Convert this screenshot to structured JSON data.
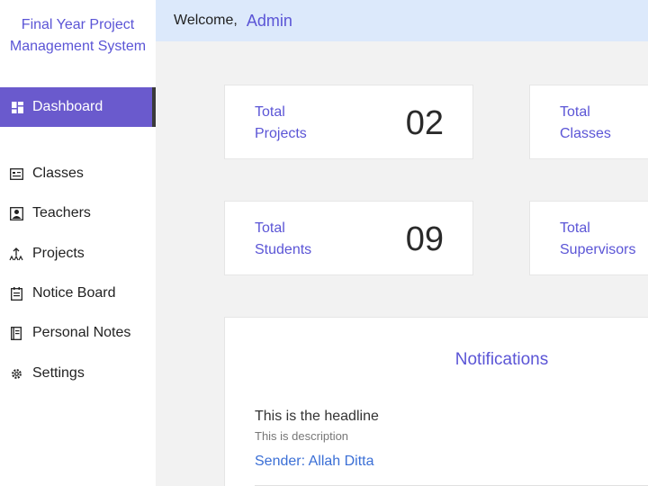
{
  "sidebar": {
    "brand_line1": "Final Year Project",
    "brand_line2": "Management System",
    "items": [
      {
        "label": "Dashboard",
        "icon": "dashboard-icon",
        "active": true
      },
      {
        "label": "Classes",
        "icon": "classes-icon"
      },
      {
        "label": "Teachers",
        "icon": "teachers-icon"
      },
      {
        "label": "Projects",
        "icon": "projects-icon"
      },
      {
        "label": "Notice Board",
        "icon": "notice-board-icon"
      },
      {
        "label": "Personal Notes",
        "icon": "personal-notes-icon"
      },
      {
        "label": "Settings",
        "icon": "settings-icon"
      }
    ]
  },
  "header": {
    "welcome": "Welcome,",
    "user": "Admin"
  },
  "cards": [
    {
      "line1": "Total",
      "line2": "Projects",
      "value": "02"
    },
    {
      "line1": "Total",
      "line2": "Classes",
      "value": ""
    },
    {
      "line1": "Total",
      "line2": "Students",
      "value": "09"
    },
    {
      "line1": "Total",
      "line2": "Supervisors",
      "value": ""
    }
  ],
  "notifications": {
    "title": "Notifications",
    "items": [
      {
        "headline": "This is the headline",
        "description": "This is description",
        "sender": "Sender: Allah Ditta"
      }
    ]
  },
  "colors": {
    "accent": "#5b55d6",
    "active_bg": "#6a5acd",
    "topbar_bg": "#dce9fb",
    "page_bg": "#f2f2f2"
  }
}
